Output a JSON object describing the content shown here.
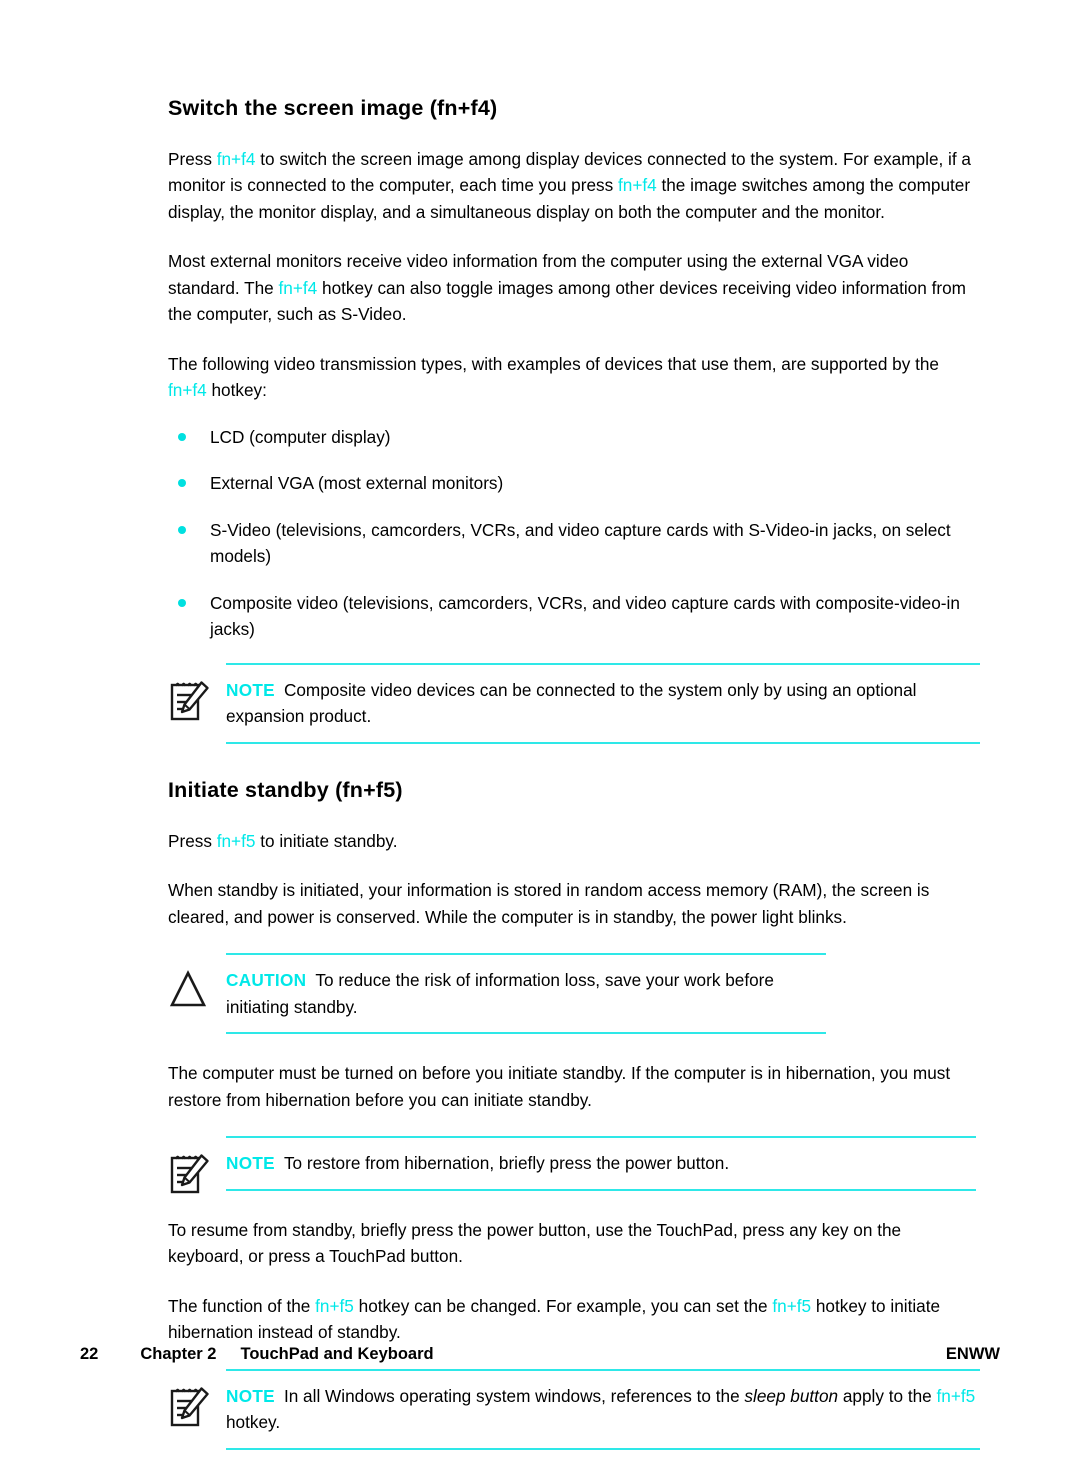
{
  "page": {
    "heading1": "Switch the screen image (fn+f4)",
    "heading2": "Initiate standby (fn+f5)"
  },
  "hotkeys": {
    "fn_f4": "fn+f4",
    "fn_f5": "fn+f5",
    "color": "#00e8e8"
  },
  "paragraphs": {
    "p1_a": "Press ",
    "p1_b": " to switch the screen image among display devices connected to the system. For example, if a monitor is connected to the computer, each time you press ",
    "p1_c": " the image switches among the computer display, the monitor display, and a simultaneous display on both the computer and the monitor.",
    "p2_a": "Most external monitors receive video information from the computer using the external VGA video standard. The ",
    "p2_b": " hotkey can also toggle images among other devices receiving video information from the computer, such as S-Video.",
    "p3_a": "The following video transmission types, with examples of devices that use them, are supported by the ",
    "p3_b": " hotkey:",
    "p4_a": "Press ",
    "p4_b": " to initiate standby.",
    "p5": "When standby is initiated, your information is stored in random access memory (RAM), the screen is cleared, and power is conserved. While the computer is in standby, the power light blinks.",
    "p6": "The computer must be turned on before you initiate standby. If the computer is in hibernation, you must restore from hibernation before you can initiate standby.",
    "p7": "To resume from standby, briefly press the power button, use the TouchPad, press any key on the keyboard, or press a TouchPad button.",
    "p8_a": "The function of the ",
    "p8_b": " hotkey can be changed. For example, you can set the ",
    "p8_c": " hotkey to initiate hibernation instead of standby."
  },
  "bullets": [
    "LCD (computer display)",
    "External VGA (most external monitors)",
    "S-Video (televisions, camcorders, VCRs, and video capture cards with S-Video-in jacks, on select models)",
    "Composite video (televisions, camcorders, VCRs, and video capture cards with composite-video-in jacks)"
  ],
  "admonitions": {
    "note1": {
      "label": "NOTE",
      "icon": "note-pad-pencil-icon",
      "text": "Composite video devices can be connected to the system only by using an optional expansion product."
    },
    "caution1": {
      "label": "CAUTION",
      "icon": "warning-triangle-icon",
      "text": "To reduce the risk of information loss, save your work before initiating standby."
    },
    "note2": {
      "label": "NOTE",
      "icon": "note-pad-pencil-icon",
      "text": "To restore from hibernation, briefly press the power button."
    },
    "note3": {
      "label": "NOTE",
      "icon": "note-pad-pencil-icon",
      "text_a": "In all Windows operating system windows, references to the ",
      "text_italic": "sleep button",
      "text_b": " apply to the ",
      "text_c": " hotkey."
    }
  },
  "footer": {
    "page_number": "22",
    "chapter": "Chapter 2",
    "chapter_title": "TouchPad and Keyboard",
    "locale": "ENWW"
  }
}
